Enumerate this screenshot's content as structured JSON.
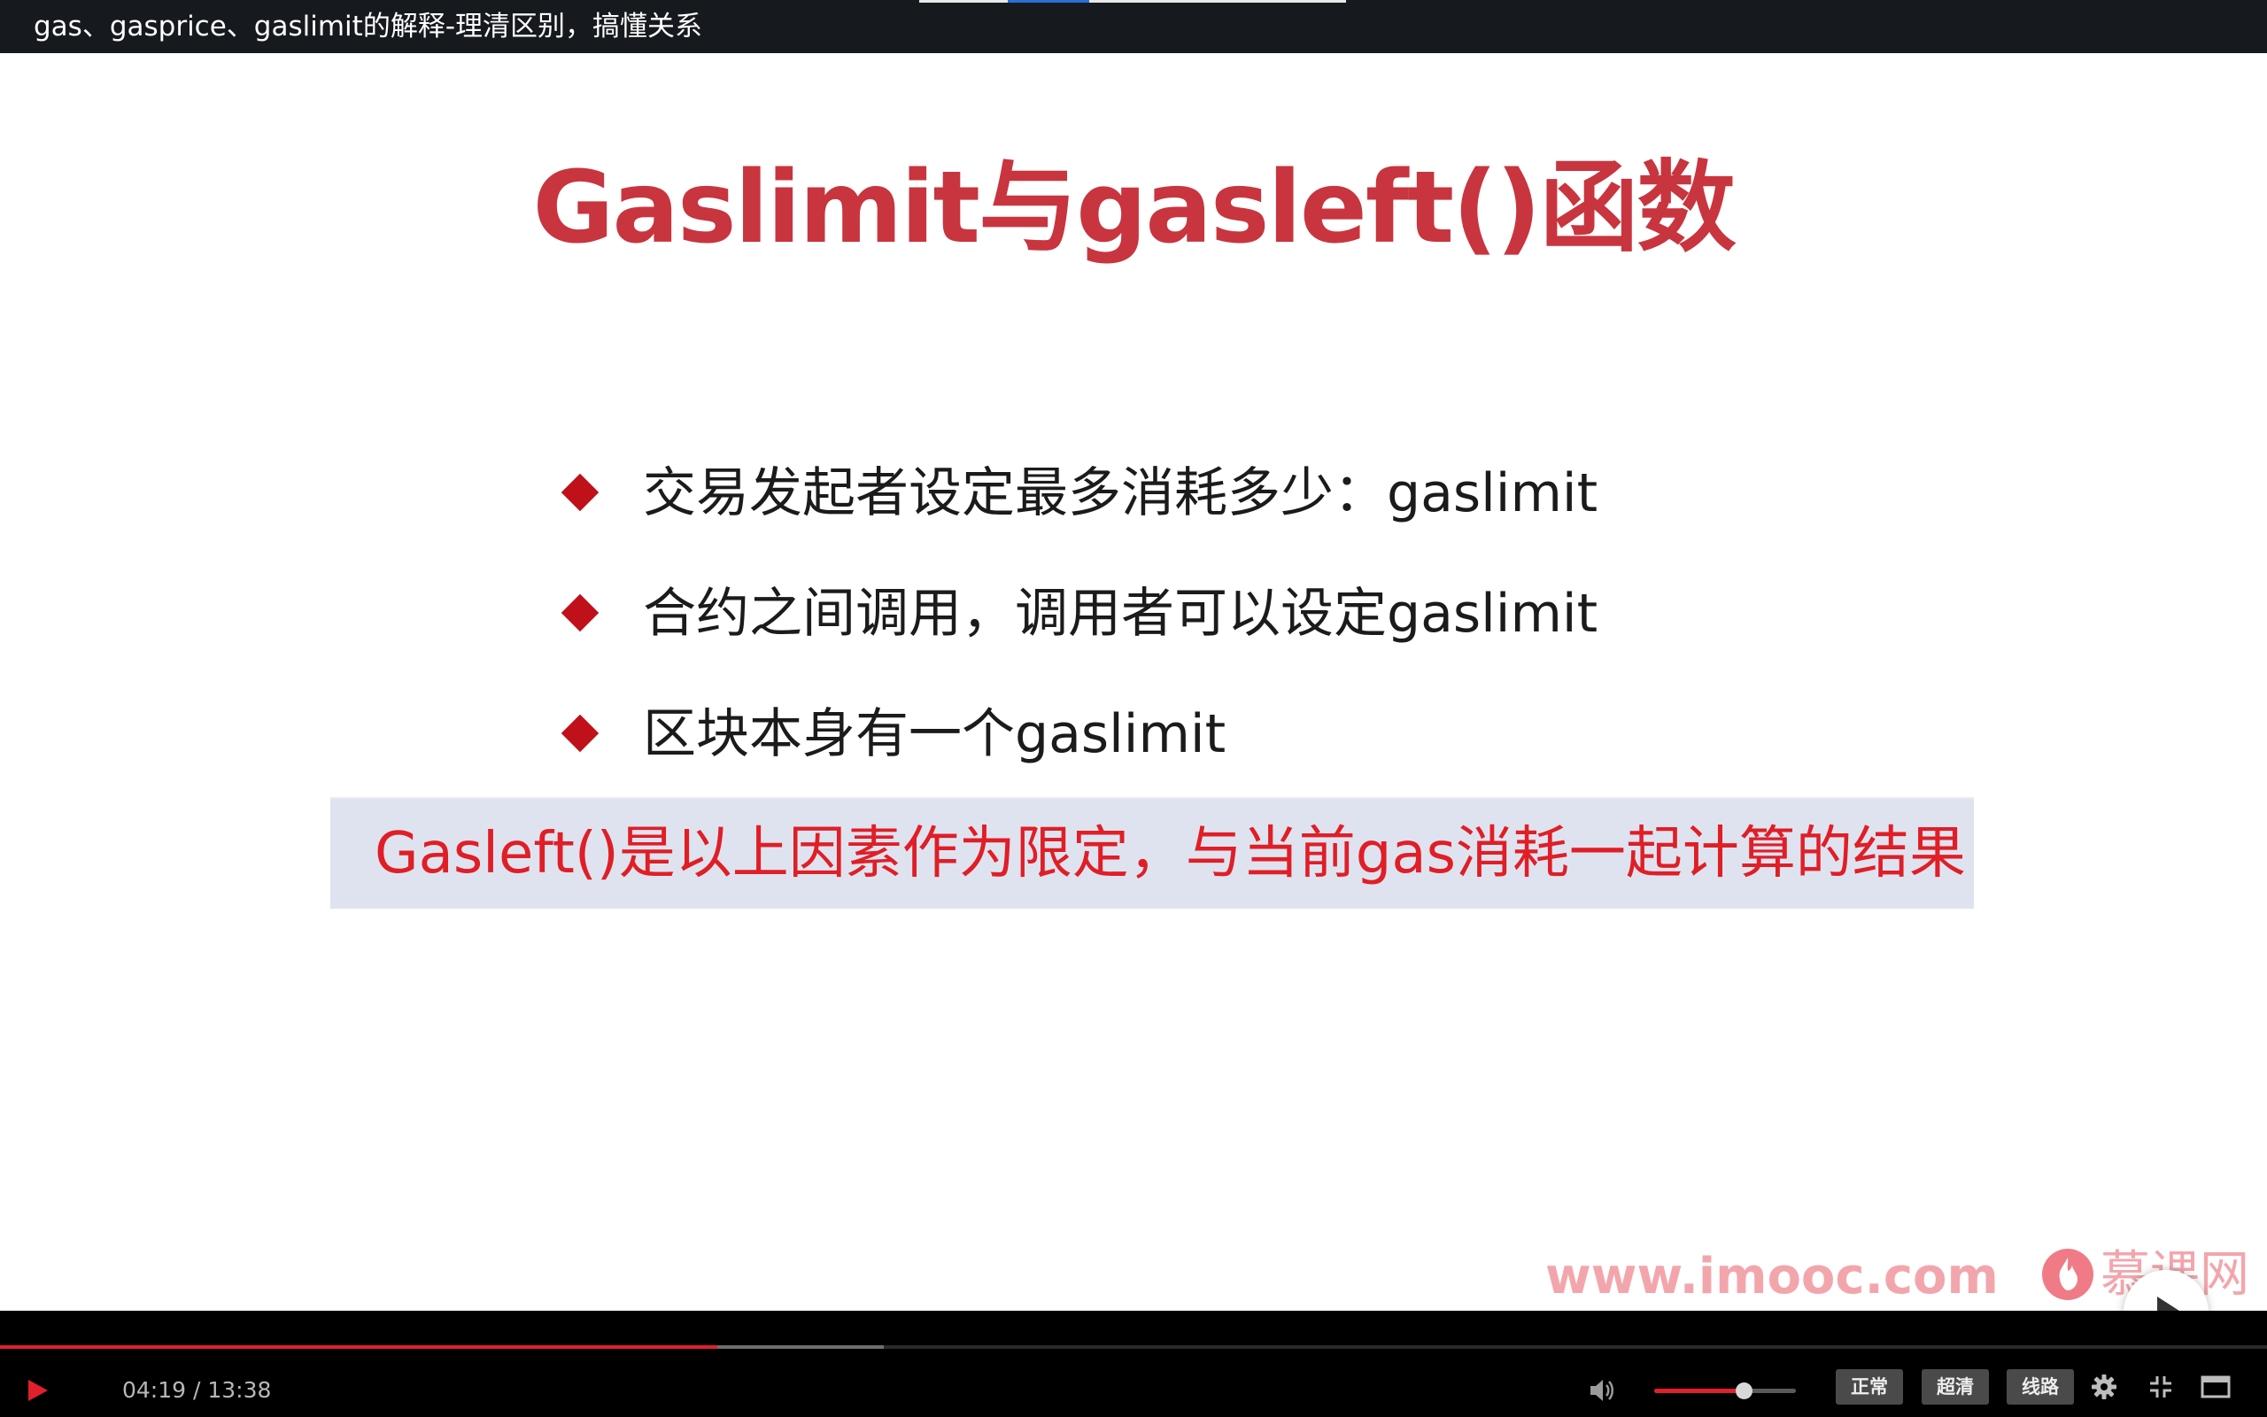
{
  "title_bar": {
    "title": "gas、gasprice、gaslimit的解释-理清区别，搞懂关系"
  },
  "slide": {
    "title": "Gaslimit与gasleft()函数",
    "bullets": [
      {
        "text": "交易发起者设定最多消耗多少：gaslimit"
      },
      {
        "text": "合约之间调用，调用者可以设定gaslimit"
      },
      {
        "text": "区块本身有一个gaslimit"
      }
    ],
    "highlight": "Gasleft()是以上因素作为限定，与当前gas消耗一起计算的结果",
    "watermark_url": "www.imooc.com",
    "brand_name": "慕课网",
    "colors": {
      "title": "#c8353f",
      "bullet": "#c0101a",
      "highlight_text": "#e01e26",
      "highlight_bg": "#dfe3f0",
      "watermark": "#f2a6ac"
    }
  },
  "player": {
    "current_time": "04:19",
    "duration": "13:38",
    "time_display": "04:19 / 13:38",
    "progress_played_fraction": 0.3166,
    "progress_buffered_fraction": 0.39,
    "volume_fraction": 0.63,
    "speed_label": "正常",
    "quality_label": "超清",
    "line_label": "线路",
    "icons": {
      "play": "play-icon",
      "volume": "volume-icon",
      "settings": "gear-icon",
      "exit_fullscreen": "exit-fullscreen-icon",
      "window_mode": "window-mode-icon",
      "center_play": "play-icon"
    },
    "colors": {
      "accent": "#e0202a",
      "bar_bg": "#000000"
    }
  }
}
